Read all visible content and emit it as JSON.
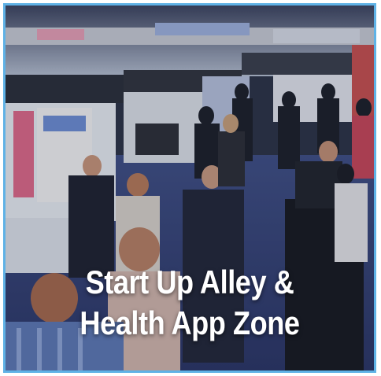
{
  "tile": {
    "caption_line1": "Start Up Alley &",
    "caption_line2": "Health App Zone",
    "border_color": "#5fb2e6"
  },
  "photo": {
    "subject": "exhibition-hall-crowd"
  }
}
